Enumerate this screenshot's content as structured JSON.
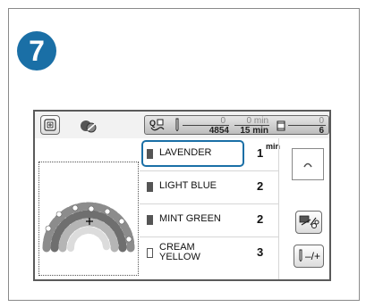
{
  "step": {
    "number": "7"
  },
  "header": {
    "stitch_current": "0",
    "stitch_total": "4854",
    "time_current": "0 min",
    "time_total": "15 min",
    "color_current": "0",
    "color_total": "6"
  },
  "thread_list": {
    "min_label": "min",
    "items": [
      {
        "name": "LAVENDER",
        "count": "1",
        "selected": true,
        "swatch": "#4a4a4a"
      },
      {
        "name": "LIGHT BLUE",
        "count": "2",
        "selected": false,
        "swatch": "#4a4a4a"
      },
      {
        "name": "MINT GREEN",
        "count": "2",
        "selected": false,
        "swatch": "#4a4a4a"
      },
      {
        "name_line1": "CREAM",
        "name_line2": "YELLOW",
        "count": "3",
        "selected": false,
        "swatch": "#ffffff"
      }
    ]
  },
  "buttons": {
    "thread_cut_icon": "scissors-icon",
    "tension_label": "–/+"
  },
  "colors": {
    "accent": "#1a6fa6",
    "badge": "#1a6fa6"
  }
}
